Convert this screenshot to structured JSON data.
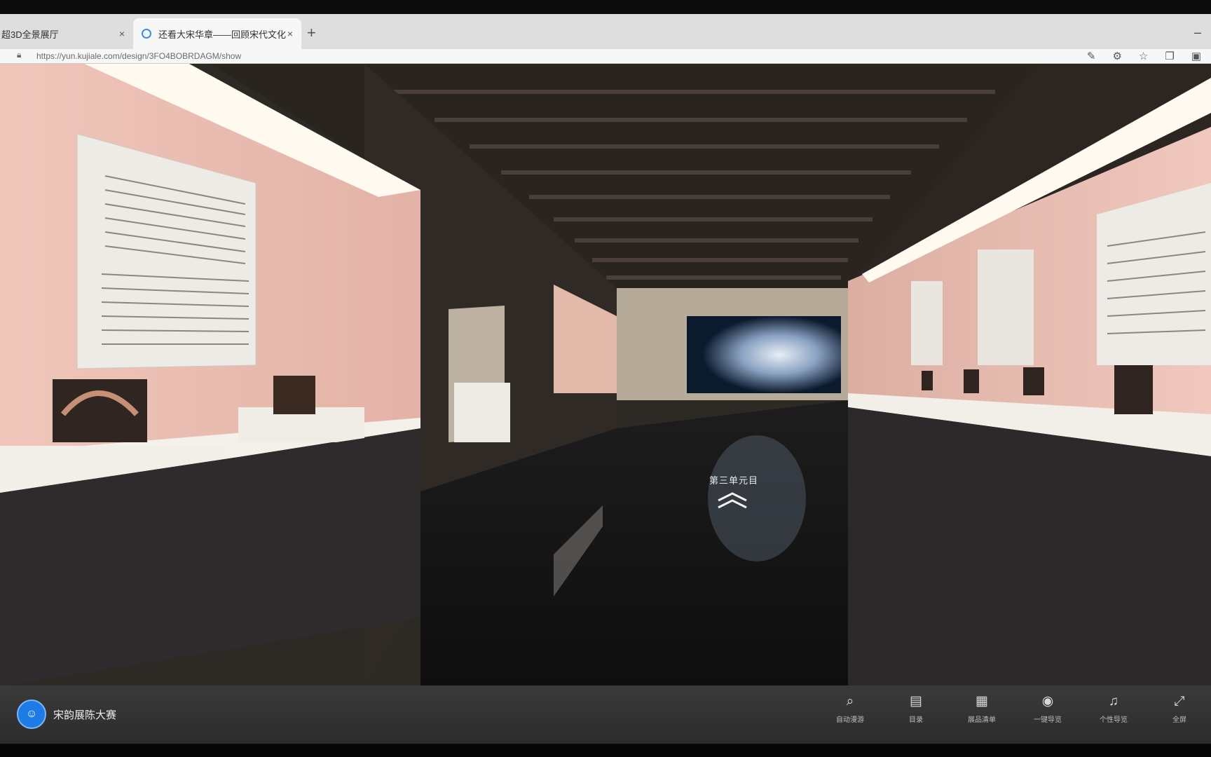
{
  "browser": {
    "tabs": [
      {
        "label": "超3D全景展厅"
      },
      {
        "label": "还看大宋华章——回顾宋代文化"
      }
    ],
    "new_tab_label": "+",
    "close_label": "×",
    "minimize_label": "–",
    "url": "https://yun.kujiale.com/design/3FO4BOBRDAGM/show",
    "colors": {
      "tabstrip": "#dedede",
      "active_tab": "#f7f7f7"
    }
  },
  "scene": {
    "hall_label": "第三单元目",
    "forward_arrow_icon": "double-chevron-up-icon"
  },
  "brand": {
    "logo_text": "☺",
    "name": "宋韵展陈大赛",
    "accent": "#1d7be6"
  },
  "toolbar": {
    "items": [
      {
        "icon": "⌕",
        "label": "自动漫游"
      },
      {
        "icon": "▤",
        "label": "目录"
      },
      {
        "icon": "▦",
        "label": "展品清单"
      },
      {
        "icon": "◉",
        "label": "一键导览"
      },
      {
        "icon": "♫",
        "label": "个性导览"
      },
      {
        "icon": "⤢",
        "label": "全屏"
      }
    ]
  }
}
